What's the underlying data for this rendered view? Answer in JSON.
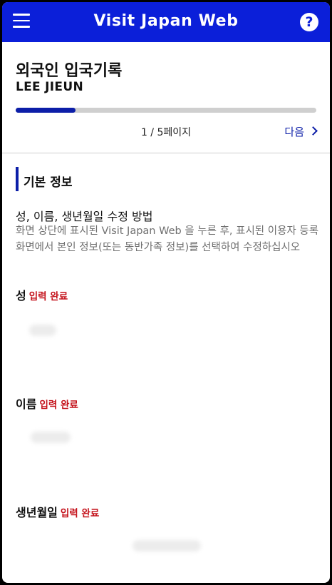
{
  "app": {
    "title": "Visit Japan Web",
    "menu_icon": "hamburger-menu-icon",
    "help_icon": "help-question-icon",
    "help_glyph": "?",
    "brand_color": "#0b1fd9"
  },
  "header": {
    "heading": "외국인 입국기록",
    "name": "LEE JIEUN"
  },
  "progress": {
    "current_page": 1,
    "total_pages": 5,
    "fraction": 0.2,
    "label": "1 / 5페이지",
    "next_label": "다음"
  },
  "section": {
    "title": "기본 정보"
  },
  "howto": {
    "title": "성, 이름, 생년월일 수정 방법",
    "text": "화면 상단에 표시된 Visit Japan Web 을 누른 후, 표시된 이용자 등록 화면에서 본인 정보(또는 동반가족 정보)를 선택하여 수정하십시오"
  },
  "fields": [
    {
      "label": "성",
      "status": "입력 완료"
    },
    {
      "label": "이름",
      "status": "입력 완료"
    },
    {
      "label": "생년월일",
      "status": "입력 완료"
    }
  ],
  "status_color": "#c4111a"
}
